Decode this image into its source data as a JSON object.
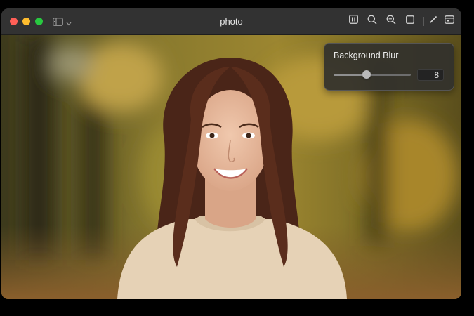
{
  "window": {
    "title": "photo"
  },
  "toolbar": {
    "icons": [
      "sidebar-icon",
      "chevron-down-icon",
      "pause-icon",
      "search-icon",
      "zoom-out-icon",
      "square-icon",
      "markup-pen-icon",
      "window-icon"
    ]
  },
  "blur_panel": {
    "title": "Background Blur",
    "value": "8",
    "slider_fraction": 0.43
  },
  "colors": {
    "close": "#ff5f57",
    "minimize": "#febc2e",
    "maximize": "#28c840",
    "titlebar": "#323232"
  }
}
